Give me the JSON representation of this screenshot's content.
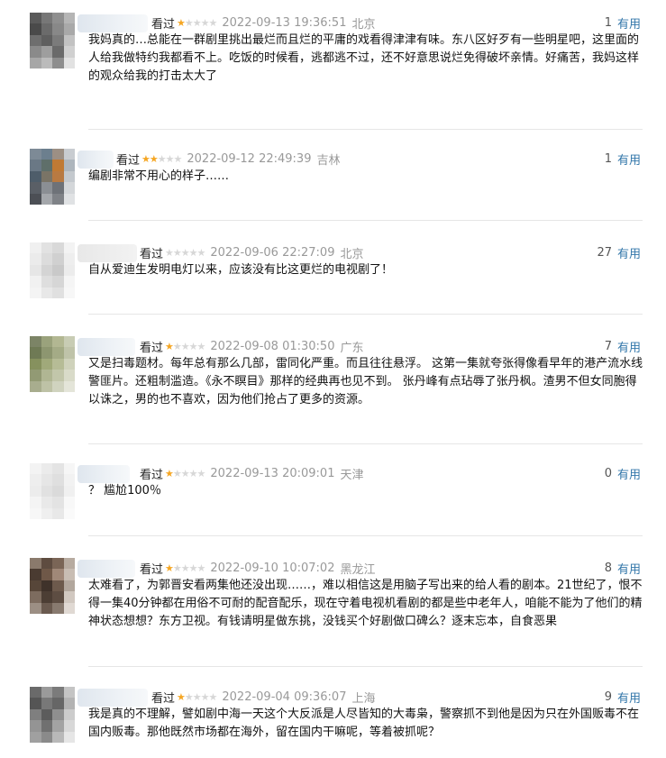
{
  "seen_label": "看过",
  "useful_label": "有用",
  "colors": {
    "star_on": "#f5a623",
    "star_off": "#d7d7d7",
    "link": "#3377aa",
    "meta": "#999999"
  },
  "comments": [
    {
      "rating": 1,
      "time": "2022-09-13 19:36:51",
      "location": "北京",
      "votes": "1",
      "text": "我妈真的…总能在一群剧里挑出最烂而且烂的平庸的戏看得津津有味。东八区好歹有一些明星吧，这里面的人给我做特约我都看不上。吃饭的时候看，逃都逃不过，还不好意思说烂免得破坏亲情。好痛苦，我妈这样的观众给我的打击太大了"
    },
    {
      "rating": 2,
      "time": "2022-09-12 22:49:39",
      "location": "吉林",
      "votes": "1",
      "text": "编剧非常不用心的样子……"
    },
    {
      "rating": 0,
      "time": "2022-09-06 22:27:09",
      "location": "北京",
      "votes": "27",
      "text": "自从爱迪生发明电灯以来，应该没有比这更烂的电视剧了！"
    },
    {
      "rating": 1,
      "time": "2022-09-08 01:30:50",
      "location": "广东",
      "votes": "7",
      "text": "又是扫毒题材。每年总有那么几部，雷同化严重。而且往往悬浮。 这第一集就夸张得像看早年的港产流水线警匪片。还粗制滥造。《永不瞑目》那样的经典再也见不到。 张丹峰有点玷辱了张丹枫。渣男不但女同胞得以诛之，男的也不喜欢，因为他们抢占了更多的资源。"
    },
    {
      "rating": 1,
      "time": "2022-09-13 20:09:01",
      "location": "天津",
      "votes": "0",
      "text": "？ 尴尬100％"
    },
    {
      "rating": 1,
      "time": "2022-09-10 10:07:02",
      "location": "黑龙江",
      "votes": "8",
      "text": "太难看了，为郭晋安看两集他还没出现……，难以相信这是用脑子写出来的给人看的剧本。21世纪了，恨不得一集40分钟都在用俗不可耐的配音配乐，现在守着电视机看剧的都是些中老年人，咱能不能为了他们的精神状态想想？东方卫视。有钱请明星做东挑，没钱买个好剧做口碑么？逐末忘本，自食恶果"
    },
    {
      "rating": 1,
      "time": "2022-09-04 09:36:07",
      "location": "上海",
      "votes": "9",
      "text": "我是真的不理解，譬如剧中海一天这个大反派是人尽皆知的大毒枭，警察抓不到他是因为只在外国贩毒不在国内贩毒。那他既然市场都在海外，留在国内干嘛呢，等着被抓呢？"
    }
  ]
}
